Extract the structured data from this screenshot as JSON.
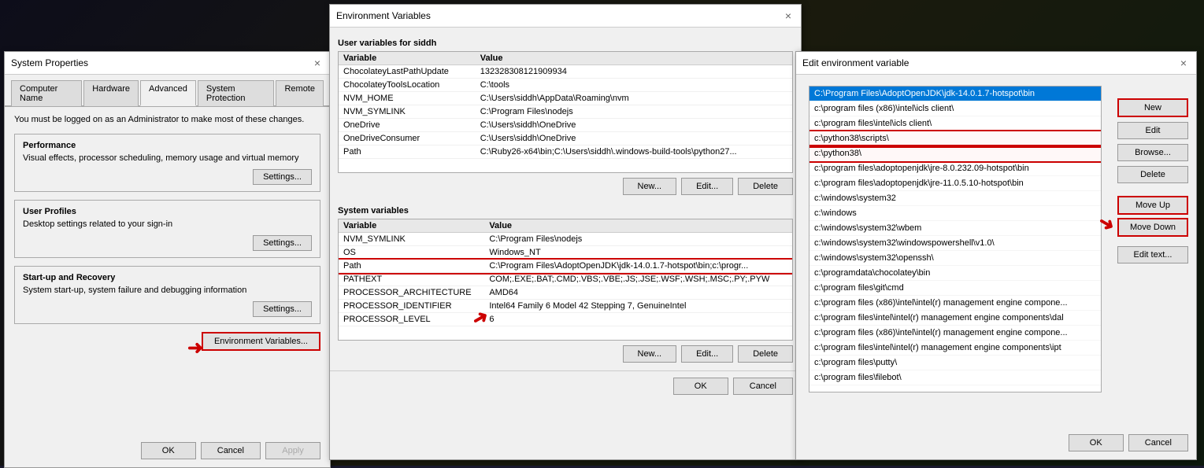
{
  "background": {
    "color": "#1a1a0d"
  },
  "system_props": {
    "title": "System Properties",
    "close_label": "×",
    "tabs": [
      {
        "id": "computer-name",
        "label": "Computer Name"
      },
      {
        "id": "hardware",
        "label": "Hardware"
      },
      {
        "id": "advanced",
        "label": "Advanced"
      },
      {
        "id": "system-protection",
        "label": "System Protection"
      },
      {
        "id": "remote",
        "label": "Remote"
      }
    ],
    "active_tab": "advanced",
    "admin_notice": "You must be logged on as an Administrator to make most of these changes.",
    "performance": {
      "title": "Performance",
      "desc": "Visual effects, processor scheduling, memory usage and virtual memory",
      "settings_label": "Settings..."
    },
    "user_profiles": {
      "title": "User Profiles",
      "desc": "Desktop settings related to your sign-in",
      "settings_label": "Settings..."
    },
    "startup_recovery": {
      "title": "Start-up and Recovery",
      "desc": "System start-up, system failure and debugging information",
      "settings_label": "Settings..."
    },
    "env_vars_btn": "Environment Variables...",
    "ok_label": "OK",
    "cancel_label": "Cancel",
    "apply_label": "Apply"
  },
  "env_vars_dialog": {
    "title": "Environment Variables",
    "close_label": "×",
    "user_vars_section": "User variables for siddh",
    "user_vars_headers": [
      "Variable",
      "Value"
    ],
    "user_vars": [
      {
        "variable": "ChocolateyLastPathUpdate",
        "value": "132328308121909934"
      },
      {
        "variable": "ChocolateyToolsLocation",
        "value": "C:\\tools"
      },
      {
        "variable": "NVM_HOME",
        "value": "C:\\Users\\siddh\\AppData\\Roaming\\nvm"
      },
      {
        "variable": "NVM_SYMLINK",
        "value": "C:\\Program Files\\nodejs"
      },
      {
        "variable": "OneDrive",
        "value": "C:\\Users\\siddh\\OneDrive"
      },
      {
        "variable": "OneDriveConsumer",
        "value": "C:\\Users\\siddh\\OneDrive"
      },
      {
        "variable": "Path",
        "value": "C:\\Ruby26-x64\\bin;C:\\Users\\siddh\\.windows-build-tools\\python27..."
      }
    ],
    "user_vars_new": "New...",
    "user_vars_edit": "Edit...",
    "user_vars_delete": "Delete",
    "system_vars_section": "System variables",
    "system_vars_headers": [
      "Variable",
      "Value"
    ],
    "system_vars": [
      {
        "variable": "NVM_SYMLINK",
        "value": "C:\\Program Files\\nodejs"
      },
      {
        "variable": "OS",
        "value": "Windows_NT"
      },
      {
        "variable": "Path",
        "value": "C:\\Program Files\\AdoptOpenJDK\\jdk-14.0.1.7-hotspot\\bin;c:\\progr...",
        "highlighted": true
      },
      {
        "variable": "PATHEXT",
        "value": "COM;.EXE;.BAT;.CMD;.VBS;.VBE;.JS;.JSE;.WSF;.WSH;.MSC;.PY;.PYW"
      },
      {
        "variable": "PROCESSOR_ARCHITECTURE",
        "value": "AMD64"
      },
      {
        "variable": "PROCESSOR_IDENTIFIER",
        "value": "Intel64 Family 6 Model 42 Stepping 7, GenuineIntel"
      },
      {
        "variable": "PROCESSOR_LEVEL",
        "value": "6"
      }
    ],
    "system_vars_new": "New...",
    "system_vars_edit": "Edit...",
    "system_vars_delete": "Delete",
    "ok_label": "OK",
    "cancel_label": "Cancel"
  },
  "edit_env_dialog": {
    "title": "Edit environment variable",
    "close_label": "×",
    "path_entries": [
      {
        "value": "C:\\Program Files\\AdoptOpenJDK\\jdk-14.0.1.7-hotspot\\bin"
      },
      {
        "value": "c:\\program files (x86)\\intel\\icls client\\"
      },
      {
        "value": "c:\\program files\\intel\\icls client\\"
      },
      {
        "value": "c:\\python38\\scripts\\",
        "highlighted": true
      },
      {
        "value": "c:\\python38\\",
        "highlighted": true
      },
      {
        "value": "c:\\program files\\adoptopenjdk\\jre-8.0.232.09-hotspot\\bin"
      },
      {
        "value": "c:\\program files\\adoptopenjdk\\jre-11.0.5.10-hotspot\\bin"
      },
      {
        "value": "c:\\windows\\system32"
      },
      {
        "value": "c:\\windows"
      },
      {
        "value": "c:\\windows\\system32\\wbem"
      },
      {
        "value": "c:\\windows\\system32\\windowspowershell\\v1.0\\"
      },
      {
        "value": "c:\\windows\\system32\\openssh\\"
      },
      {
        "value": "c:\\programdata\\chocolatey\\bin"
      },
      {
        "value": "c:\\program files\\git\\cmd"
      },
      {
        "value": "c:\\program files (x86)\\intel\\intel(r) management engine compone..."
      },
      {
        "value": "c:\\program files\\intel\\intel(r) management engine components\\dal"
      },
      {
        "value": "c:\\program files (x86)\\intel\\intel(r) management engine compone..."
      },
      {
        "value": "c:\\program files\\intel\\intel(r) management engine components\\ipt"
      },
      {
        "value": "c:\\program files\\putty\\"
      },
      {
        "value": "c:\\program files\\filebot\\"
      }
    ],
    "new_label": "New",
    "edit_label": "Edit",
    "browse_label": "Browse...",
    "delete_label": "Delete",
    "move_up_label": "Move Up",
    "move_down_label": "Move Down",
    "edit_text_label": "Edit text...",
    "ok_label": "OK",
    "cancel_label": "Cancel"
  }
}
